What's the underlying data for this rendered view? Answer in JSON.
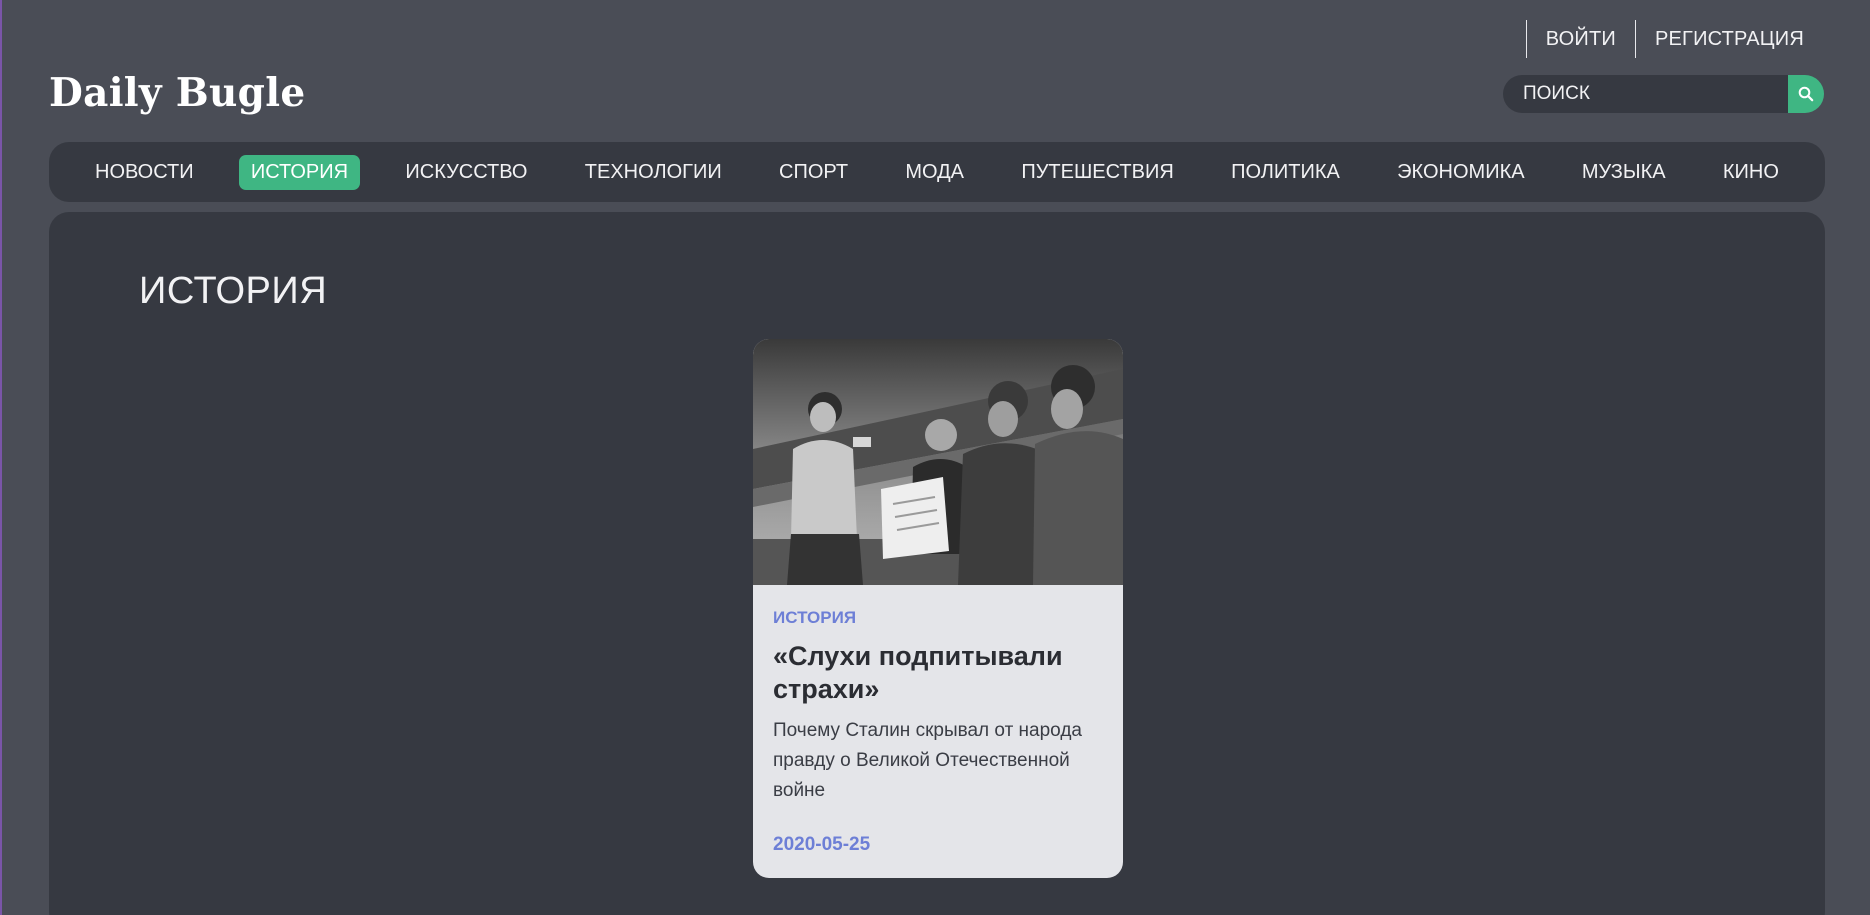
{
  "auth": {
    "login": "ВОЙТИ",
    "register": "РЕГИСТРАЦИЯ"
  },
  "header": {
    "logo": "Daily Bugle",
    "search_placeholder": "ПОИСК",
    "search_icon": "search-icon"
  },
  "nav": {
    "items": [
      {
        "label": "НОВОСТИ"
      },
      {
        "label": "ИСТОРИЯ",
        "active": true
      },
      {
        "label": "ИСКУССТВО"
      },
      {
        "label": "ТЕХНОЛОГИИ"
      },
      {
        "label": "СПОРТ"
      },
      {
        "label": "МОДА"
      },
      {
        "label": "ПУТЕШЕСТВИЯ"
      },
      {
        "label": "ПОЛИТИКА"
      },
      {
        "label": "ЭКОНОМИКА"
      },
      {
        "label": "МУЗЫКА"
      },
      {
        "label": "КИНО"
      }
    ]
  },
  "main": {
    "title": "ИСТОРИЯ",
    "articles": [
      {
        "category": "ИСТОРИЯ",
        "title": "«Слухи подпитывали страхи»",
        "description": "Почему Сталин скрывал от народа правду о Великой Отечественной войне",
        "date": "2020-05-25",
        "image": "black-and-white-photo-soldiers-reading-newspaper"
      }
    ]
  },
  "colors": {
    "background": "#4a4d56",
    "panel": "#363941",
    "accent": "#3fb683",
    "card": "#e4e5e9",
    "category": "#6d7fd6"
  }
}
